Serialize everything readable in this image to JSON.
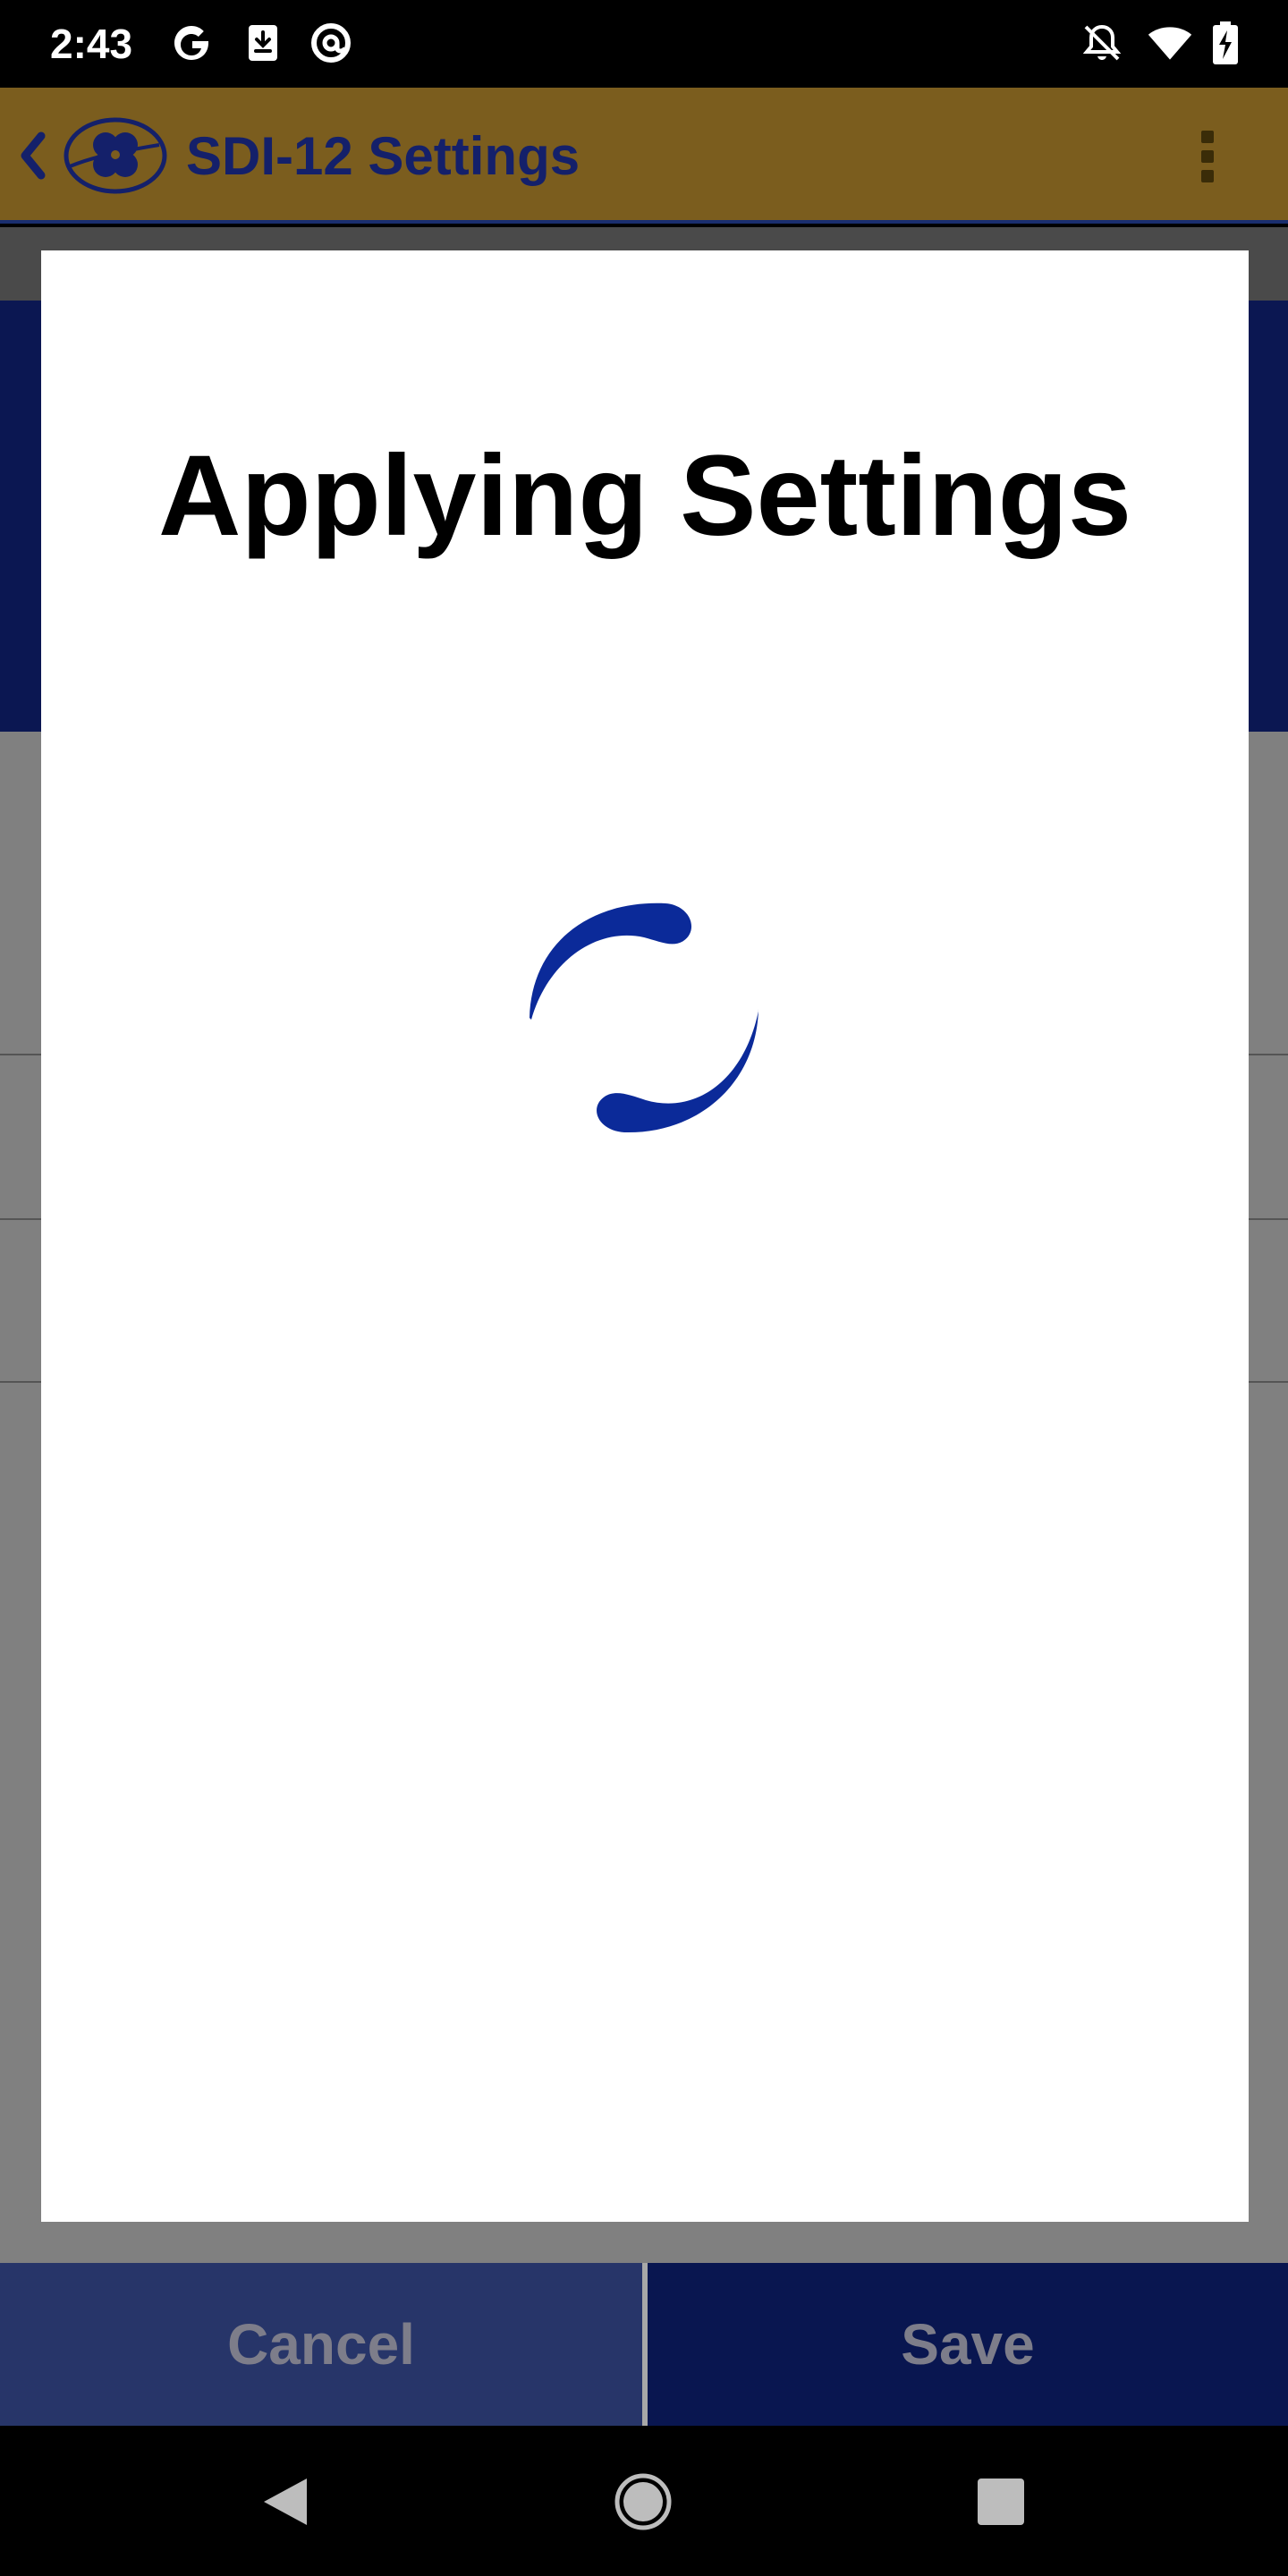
{
  "status_bar": {
    "time": "2:43",
    "left_icons": [
      "google-icon",
      "download-icon",
      "at-sign-icon"
    ],
    "right_icons": [
      "notifications-off-icon",
      "wifi-icon",
      "battery-charging-icon"
    ]
  },
  "app_bar": {
    "title": "SDI-12 Settings",
    "colors": {
      "background": "#7b5d1e",
      "title": "#14206a"
    }
  },
  "dialog": {
    "title": "Applying Settings",
    "spinner_color": "#0b2a99"
  },
  "actions": {
    "cancel_label": "Cancel",
    "save_label": "Save"
  },
  "nav_bar": {
    "icons": [
      "back-triangle-icon",
      "home-circle-icon",
      "recents-square-icon"
    ]
  }
}
